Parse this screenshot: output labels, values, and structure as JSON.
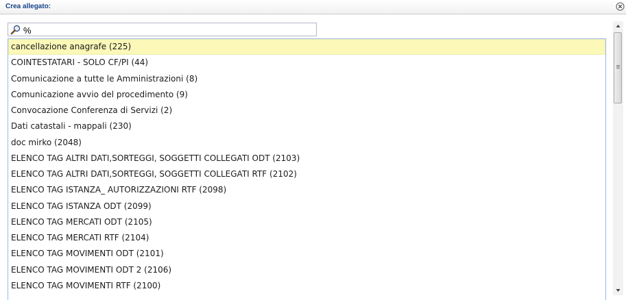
{
  "dialog": {
    "title": "Crea allegato:"
  },
  "search": {
    "value": "%"
  },
  "list": {
    "selected_index": 0,
    "items": [
      "cancellazione anagrafe (225)",
      "COINTESTATARI - SOLO CF/PI (44)",
      "Comunicazione a tutte le Amministrazioni (8)",
      "Comunicazione avvio del procedimento (9)",
      "Convocazione Conferenza di Servizi (2)",
      "Dati catastali - mappali (230)",
      "doc mirko (2048)",
      "ELENCO TAG ALTRI DATI,SORTEGGI, SOGGETTI COLLEGATI ODT (2103)",
      "ELENCO TAG ALTRI DATI,SORTEGGI, SOGGETTI COLLEGATI RTF (2102)",
      "ELENCO TAG ISTANZA_ AUTORIZZAZIONI RTF (2098)",
      "ELENCO TAG ISTANZA ODT (2099)",
      "ELENCO TAG MERCATI ODT (2105)",
      "ELENCO TAG MERCATI RTF (2104)",
      "ELENCO TAG MOVIMENTI ODT (2101)",
      "ELENCO TAG MOVIMENTI ODT 2 (2106)",
      "ELENCO TAG MOVIMENTI RTF (2100)"
    ]
  },
  "colors": {
    "title": "#15428b",
    "selected_row": "#fbf8b8",
    "list_border": "#99bbe8"
  },
  "icons": [
    "close-icon",
    "search-icon",
    "scroll-up-icon",
    "scroll-down-icon"
  ]
}
